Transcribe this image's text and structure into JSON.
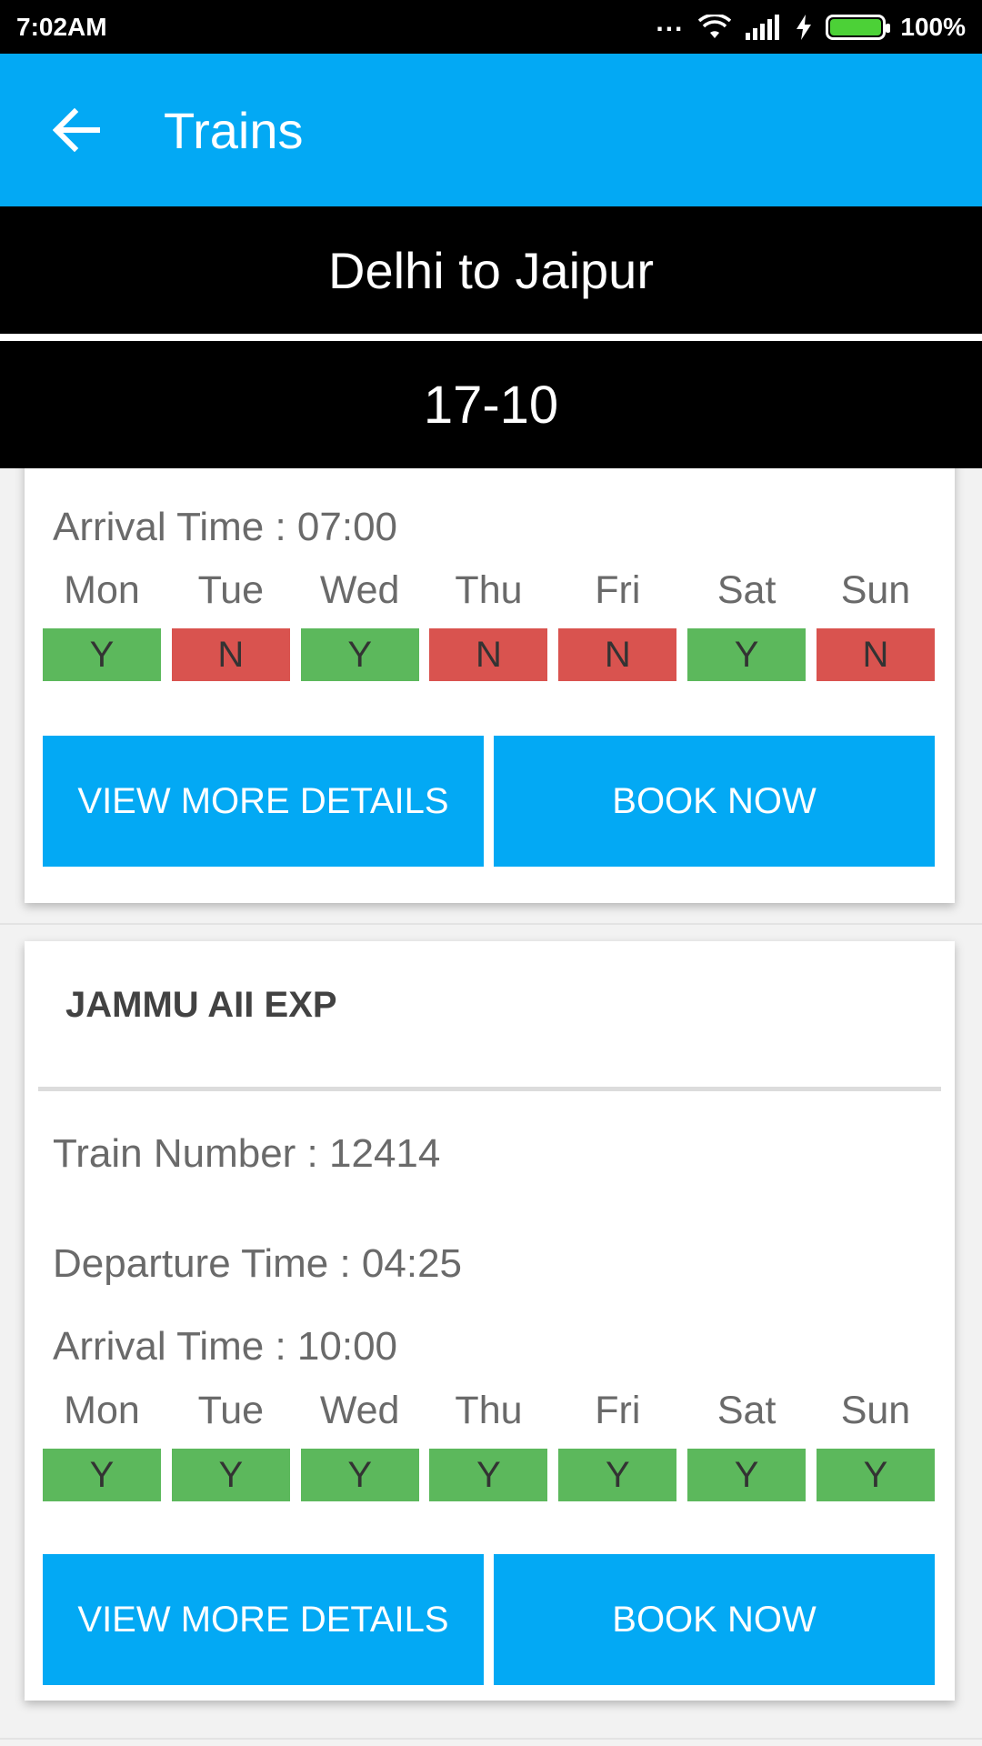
{
  "status_bar": {
    "time": "7:02AM",
    "dots": "...",
    "battery": "100%"
  },
  "app_bar": {
    "title": "Trains",
    "back_icon": "arrow-left-icon"
  },
  "route": "Delhi to Jaipur",
  "date": "17-10",
  "colors": {
    "primary": "#03a9f4",
    "available": "#5cb85c",
    "unavailable": "#d9534f"
  },
  "cards": [
    {
      "arrival": "Arrival Time : 07:00",
      "days": [
        {
          "label": "Mon",
          "value": "Y"
        },
        {
          "label": "Tue",
          "value": "N"
        },
        {
          "label": "Wed",
          "value": "Y"
        },
        {
          "label": "Thu",
          "value": "N"
        },
        {
          "label": "Fri",
          "value": "N"
        },
        {
          "label": "Sat",
          "value": "Y"
        },
        {
          "label": "Sun",
          "value": "N"
        }
      ],
      "details_label": "VIEW MORE DETAILS",
      "book_label": "BOOK NOW"
    },
    {
      "name": "JAMMU AII EXP",
      "train_number": "Train Number : 12414",
      "departure": "Departure Time : 04:25",
      "arrival": "Arrival Time : 10:00",
      "days": [
        {
          "label": "Mon",
          "value": "Y"
        },
        {
          "label": "Tue",
          "value": "Y"
        },
        {
          "label": "Wed",
          "value": "Y"
        },
        {
          "label": "Thu",
          "value": "Y"
        },
        {
          "label": "Fri",
          "value": "Y"
        },
        {
          "label": "Sat",
          "value": "Y"
        },
        {
          "label": "Sun",
          "value": "Y"
        }
      ],
      "details_label": "VIEW MORE DETAILS",
      "book_label": "BOOK NOW"
    }
  ]
}
